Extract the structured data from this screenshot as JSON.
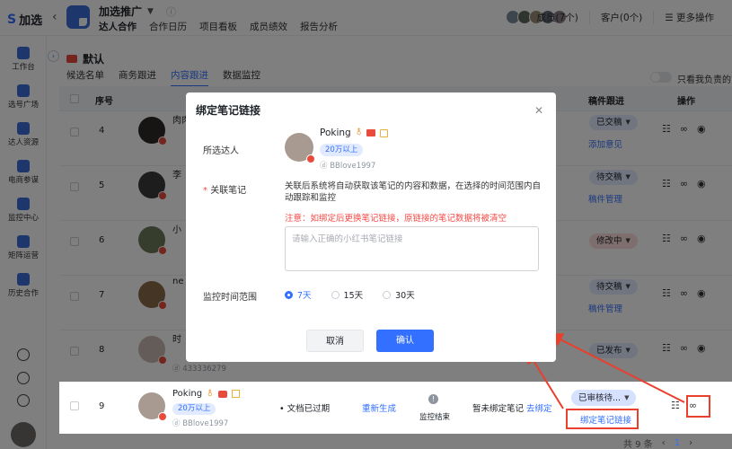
{
  "app": {
    "brand": "加选",
    "project_title": "加选推广"
  },
  "top_tabs": [
    "达人合作",
    "合作日历",
    "项目看板",
    "成员绩效",
    "报告分析"
  ],
  "top_right": {
    "members": "成员(7个)",
    "clients": "客户(0个)",
    "more": "更多操作"
  },
  "sidebar": {
    "items": [
      "工作台",
      "选号广场",
      "达人资源",
      "电商参谋",
      "监控中心",
      "矩阵运营",
      "历史合作"
    ]
  },
  "project": {
    "name": "默认"
  },
  "sub_tabs": [
    "候选名单",
    "商务跟进",
    "内容跟进",
    "数据监控"
  ],
  "toggle_label": "只看我负责的",
  "table": {
    "headers": {
      "index": "序号",
      "note_follow": "稿件跟进",
      "actions": "操作"
    },
    "rows": [
      {
        "index": "4",
        "name": "肉肉",
        "status": "已交稿",
        "action_link": "添加意见"
      },
      {
        "index": "5",
        "name": "李",
        "status": "待交稿",
        "action_link": "稿件管理"
      },
      {
        "index": "6",
        "name": "小",
        "status": "修改中",
        "action_link": ""
      },
      {
        "index": "7",
        "name": "ne",
        "status": "待交稿",
        "action_link": "稿件管理"
      },
      {
        "index": "8",
        "name": "时",
        "id": "433336279",
        "status": "已发布",
        "action_link": ""
      }
    ],
    "row9": {
      "index": "9",
      "name": "Poking",
      "fans": "20万以上",
      "id": "BBlove1997",
      "doc_status": "文档已过期",
      "regen": "重新生成",
      "monitor": "监控结束",
      "bind_status": "暂未绑定笔记",
      "bind_link": "去绑定",
      "status": "已审核待...",
      "bind_note_link": "绑定笔记链接"
    }
  },
  "pagination": {
    "total": "共 9 条",
    "current": "1"
  },
  "modal": {
    "title": "绑定笔记链接",
    "selected_label": "所选达人",
    "influencer_name": "Poking",
    "fans_badge": "20万以上",
    "influencer_id": "BBlove1997",
    "note_label": "关联笔记",
    "description": "关联后系统将自动获取该笔记的内容和数据，在选择的时间范围内自动跟踪和监控",
    "warning": "注意：如绑定后更换笔记链接，原链接的笔记数据将被清空",
    "input_placeholder": "请输入正确的小红书笔记链接",
    "range_label": "监控时间范围",
    "range_options": [
      "7天",
      "15天",
      "30天"
    ],
    "cancel": "取消",
    "confirm": "确认"
  },
  "colors": {
    "primary": "#3370ff",
    "warning": "#f54a45",
    "callout": "#e8402c",
    "pill_blue": "#e1eaff",
    "pill_red": "#ffdddd"
  }
}
